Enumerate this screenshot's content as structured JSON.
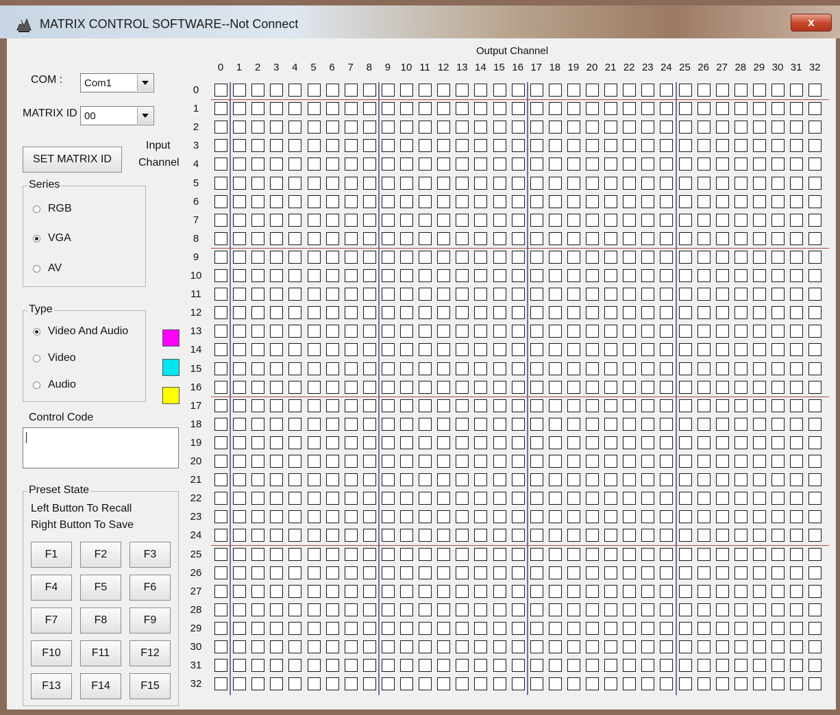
{
  "window": {
    "title": "MATRIX CONTROL SOFTWARE--Not Connect",
    "close_label": "x"
  },
  "left_panel": {
    "com_label": "COM :",
    "com_value": "Com1",
    "matrix_id_label": "MATRIX ID",
    "matrix_id_value": "00",
    "set_matrix_id_button": "SET MATRIX ID",
    "input_channel_label_1": "Input",
    "input_channel_label_2": "Channel",
    "series": {
      "title": "Series",
      "options": [
        "RGB",
        "VGA",
        "AV"
      ],
      "selected": "VGA"
    },
    "type": {
      "title": "Type",
      "options": [
        "Video And Audio",
        "Video",
        "Audio"
      ],
      "selected": "Video And Audio",
      "swatch_colors": [
        "#ff00ff",
        "#00e5f0",
        "#ffff00"
      ]
    },
    "control_code": {
      "label": "Control Code",
      "value": ""
    },
    "preset_state": {
      "title": "Preset State",
      "line1": "Left Button To Recall",
      "line2": "Right Button To Save",
      "buttons": [
        "F1",
        "F2",
        "F3",
        "F4",
        "F5",
        "F6",
        "F7",
        "F8",
        "F9",
        "F10",
        "F11",
        "F12",
        "F13",
        "F14",
        "F15"
      ]
    }
  },
  "matrix": {
    "output_channel_label": "Output Channel",
    "outputs": [
      "0",
      "1",
      "2",
      "3",
      "4",
      "5",
      "6",
      "7",
      "8",
      "9",
      "10",
      "11",
      "12",
      "13",
      "14",
      "15",
      "16",
      "17",
      "18",
      "19",
      "20",
      "21",
      "22",
      "23",
      "24",
      "25",
      "26",
      "27",
      "28",
      "29",
      "30",
      "31",
      "32"
    ],
    "inputs": [
      "0",
      "1",
      "2",
      "3",
      "4",
      "5",
      "6",
      "7",
      "8",
      "9",
      "10",
      "11",
      "12",
      "13",
      "14",
      "15",
      "16",
      "17",
      "18",
      "19",
      "20",
      "21",
      "22",
      "23",
      "24",
      "25",
      "26",
      "27",
      "28",
      "29",
      "30",
      "31",
      "32"
    ]
  }
}
